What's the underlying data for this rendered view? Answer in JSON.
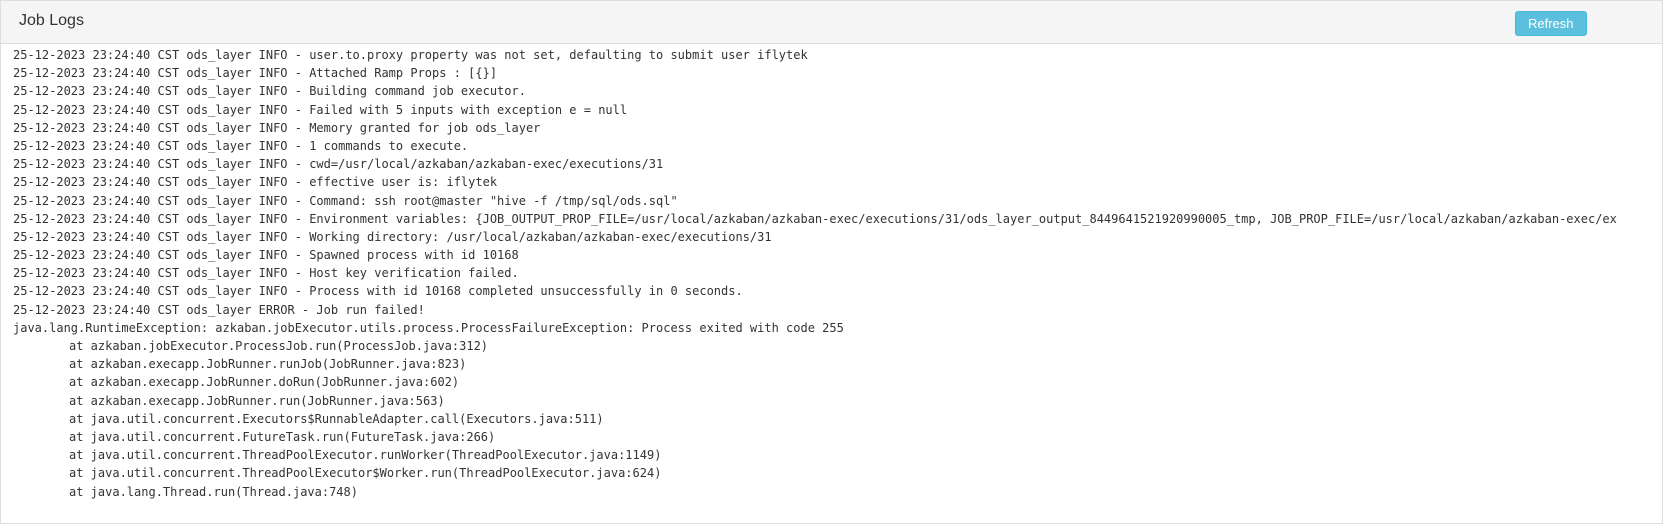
{
  "header": {
    "title": "Job Logs",
    "refresh_label": "Refresh"
  },
  "log": {
    "lines": [
      "25-12-2023 23:24:40 CST ods_layer INFO - user.to.proxy property was not set, defaulting to submit user iflytek",
      "25-12-2023 23:24:40 CST ods_layer INFO - Attached Ramp Props : [{}]",
      "25-12-2023 23:24:40 CST ods_layer INFO - Building command job executor.",
      "25-12-2023 23:24:40 CST ods_layer INFO - Failed with 5 inputs with exception e = null",
      "25-12-2023 23:24:40 CST ods_layer INFO - Memory granted for job ods_layer",
      "25-12-2023 23:24:40 CST ods_layer INFO - 1 commands to execute.",
      "25-12-2023 23:24:40 CST ods_layer INFO - cwd=/usr/local/azkaban/azkaban-exec/executions/31",
      "25-12-2023 23:24:40 CST ods_layer INFO - effective user is: iflytek",
      "25-12-2023 23:24:40 CST ods_layer INFO - Command: ssh root@master \"hive -f /tmp/sql/ods.sql\"",
      "25-12-2023 23:24:40 CST ods_layer INFO - Environment variables: {JOB_OUTPUT_PROP_FILE=/usr/local/azkaban/azkaban-exec/executions/31/ods_layer_output_8449641521920990005_tmp, JOB_PROP_FILE=/usr/local/azkaban/azkaban-exec/ex",
      "25-12-2023 23:24:40 CST ods_layer INFO - Working directory: /usr/local/azkaban/azkaban-exec/executions/31",
      "25-12-2023 23:24:40 CST ods_layer INFO - Spawned process with id 10168",
      "25-12-2023 23:24:40 CST ods_layer INFO - Host key verification failed.",
      "25-12-2023 23:24:40 CST ods_layer INFO - Process with id 10168 completed unsuccessfully in 0 seconds.",
      "25-12-2023 23:24:40 CST ods_layer ERROR - Job run failed!",
      "java.lang.RuntimeException: azkaban.jobExecutor.utils.process.ProcessFailureException: Process exited with code 255"
    ],
    "stack": [
      "at azkaban.jobExecutor.ProcessJob.run(ProcessJob.java:312)",
      "at azkaban.execapp.JobRunner.runJob(JobRunner.java:823)",
      "at azkaban.execapp.JobRunner.doRun(JobRunner.java:602)",
      "at azkaban.execapp.JobRunner.run(JobRunner.java:563)",
      "at java.util.concurrent.Executors$RunnableAdapter.call(Executors.java:511)",
      "at java.util.concurrent.FutureTask.run(FutureTask.java:266)",
      "at java.util.concurrent.ThreadPoolExecutor.runWorker(ThreadPoolExecutor.java:1149)",
      "at java.util.concurrent.ThreadPoolExecutor$Worker.run(ThreadPoolExecutor.java:624)",
      "at java.lang.Thread.run(Thread.java:748)"
    ]
  },
  "colors": {
    "accent": "#5bc0de",
    "text": "#333333",
    "header_bg": "#f5f5f5"
  }
}
